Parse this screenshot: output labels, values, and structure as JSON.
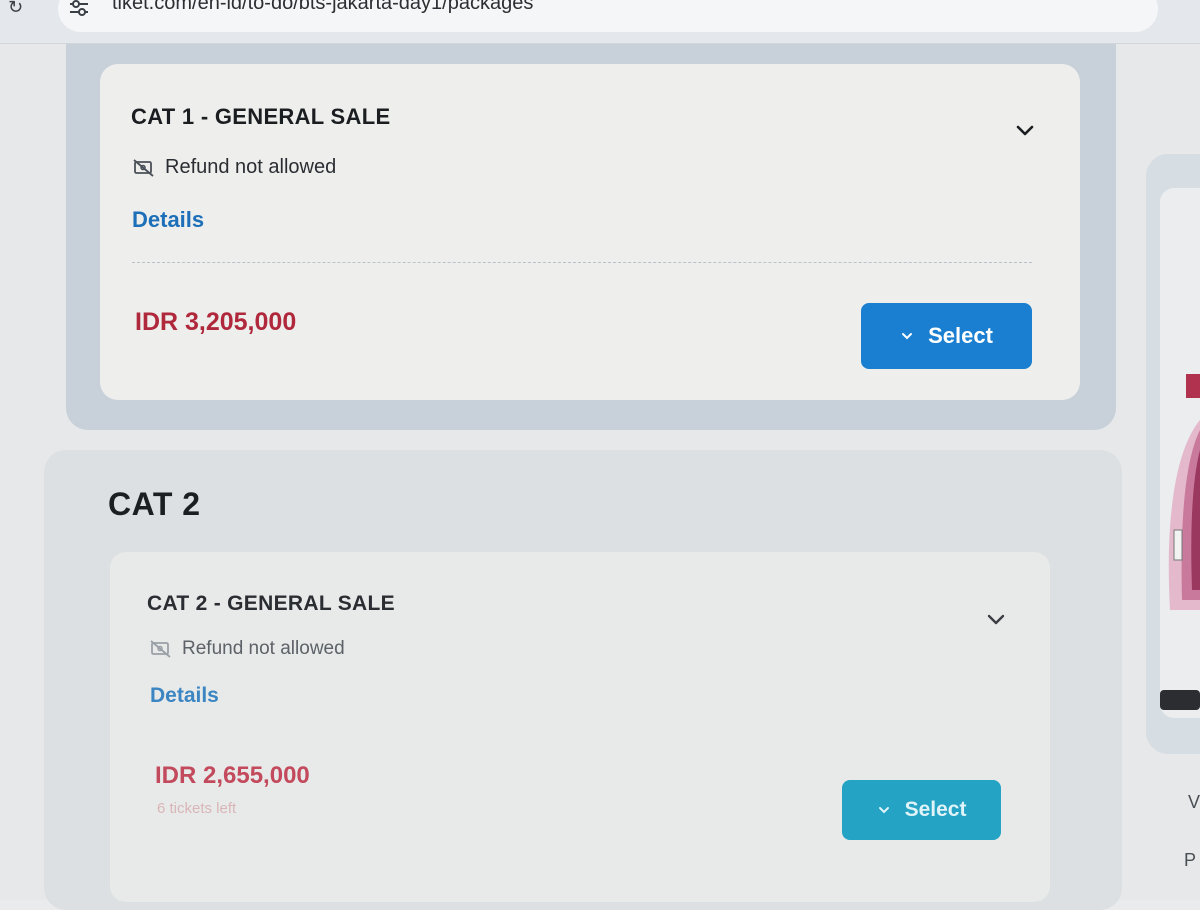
{
  "browser": {
    "url": "tiket.com/en-id/to-do/bts-jakarta-day1/packages"
  },
  "cat1": {
    "title": "CAT 1 - GENERAL SALE",
    "refund_text": "Refund not allowed",
    "details_label": "Details",
    "price": "IDR 3,205,000",
    "select_label": "Select",
    "select_color": "#1a7fd0"
  },
  "cat2": {
    "heading": "CAT 2",
    "title": "CAT 2 - GENERAL SALE",
    "refund_text": "Refund not allowed",
    "details_label": "Details",
    "price": "IDR 2,655,000",
    "tickets_left": "6 tickets left",
    "select_label": "Select",
    "select_color": "#24a3c4"
  },
  "right_panel": {
    "letters": [
      "V",
      "P"
    ]
  },
  "colors": {
    "price": "#b0283c",
    "link": "#1c6fb8"
  }
}
